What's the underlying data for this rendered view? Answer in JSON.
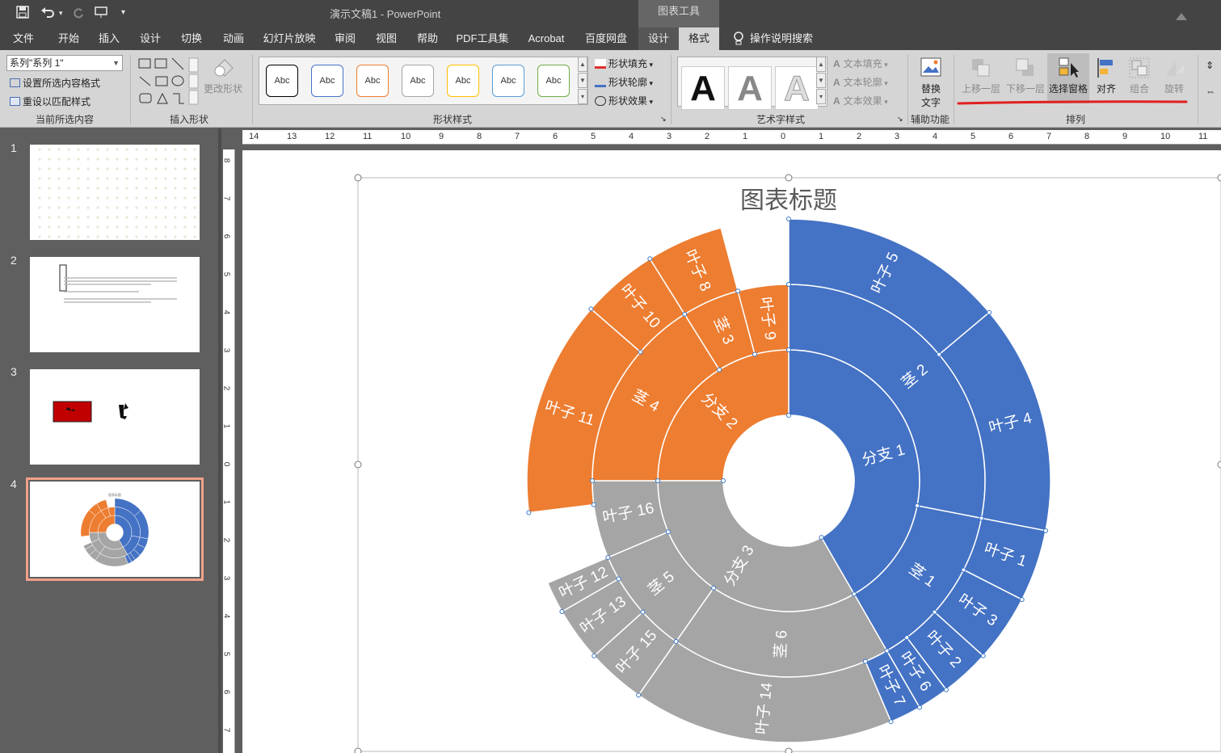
{
  "window": {
    "title": "演示文稿1  -  PowerPoint",
    "tool_context": "图表工具"
  },
  "quick_access": [
    "save-icon",
    "undo-icon",
    "redo-icon",
    "slideshow-icon",
    "customize-icon"
  ],
  "tabs": [
    {
      "label": "文件"
    },
    {
      "label": "开始"
    },
    {
      "label": "插入"
    },
    {
      "label": "设计"
    },
    {
      "label": "切换"
    },
    {
      "label": "动画"
    },
    {
      "label": "幻灯片放映"
    },
    {
      "label": "审阅"
    },
    {
      "label": "视图"
    },
    {
      "label": "帮助"
    },
    {
      "label": "PDF工具集"
    },
    {
      "label": "Acrobat"
    },
    {
      "label": "百度网盘"
    },
    {
      "label": "设计"
    },
    {
      "label": "格式"
    },
    {
      "label": "操作说明搜索"
    }
  ],
  "ribbon": {
    "current_selection": {
      "combo_value": "系列\"系列 1\"",
      "format_selection": "设置所选内容格式",
      "reset_style": "重设以匹配样式",
      "group_label": "当前所选内容"
    },
    "insert_shapes": {
      "change_shape": "更改形状",
      "group_label": "插入形状"
    },
    "shape_styles": {
      "sample_text": "Abc",
      "fill": "形状填充",
      "outline": "形状轮廓",
      "effects": "形状效果",
      "group_label": "形状样式",
      "swatch_colors": [
        "#000000",
        "#4472c4",
        "#ed7d31",
        "#a5a5a5",
        "#ffc000",
        "#5b9bd5",
        "#70ad47"
      ]
    },
    "wordart": {
      "sample": "A",
      "text_fill": "文本填充",
      "text_outline": "文本轮廓",
      "text_effects": "文本效果",
      "group_label": "艺术字样式"
    },
    "accessibility": {
      "alt_text_line1": "替换",
      "alt_text_line2": "文字",
      "group_label": "辅助功能"
    },
    "arrange": {
      "bring_forward": "上移一层",
      "send_backward": "下移一层",
      "selection_pane": "选择窗格",
      "align": "对齐",
      "group": "组合",
      "rotate": "旋转",
      "group_label": "排列",
      "annotation_color": "#e0201e"
    }
  },
  "slides": [
    {
      "number": "1"
    },
    {
      "number": "2"
    },
    {
      "number": "3"
    },
    {
      "number": "4"
    }
  ],
  "ruler": {
    "horizontal": [
      "14",
      "13",
      "12",
      "11",
      "10",
      "9",
      "8",
      "7",
      "6",
      "5",
      "4",
      "3",
      "2",
      "1",
      "0",
      "1",
      "2",
      "3",
      "4",
      "5",
      "6",
      "7",
      "8",
      "9",
      "10",
      "11"
    ],
    "vertical": [
      "8",
      "7",
      "6",
      "5",
      "4",
      "3",
      "2",
      "1",
      "0",
      "1",
      "2",
      "3",
      "4",
      "5",
      "6",
      "7"
    ]
  },
  "chart_data": {
    "type": "sunburst",
    "title": "图表标题",
    "colors": {
      "分支 1": "#4472c4",
      "分支 2": "#ed7d31",
      "分支 3": "#a5a5a5"
    },
    "segments": [
      {
        "level": 1,
        "label": "分支 1",
        "branch": "分支 1",
        "start": 0,
        "end": 150
      },
      {
        "level": 1,
        "label": "分支 2",
        "branch": "分支 2",
        "start": 270,
        "end": 360
      },
      {
        "level": 1,
        "label": "分支 3",
        "branch": "分支 3",
        "start": 150,
        "end": 270
      },
      {
        "level": 2,
        "label": "茎 2",
        "branch": "分支 1",
        "start": 0,
        "end": 101
      },
      {
        "level": 2,
        "label": "茎 1",
        "branch": "分支 1",
        "start": 101,
        "end": 150
      },
      {
        "level": 2,
        "label": "茎 6",
        "branch": "分支 3",
        "start": 150,
        "end": 215
      },
      {
        "level": 2,
        "label": "茎 5",
        "branch": "分支 3",
        "start": 215,
        "end": 247
      },
      {
        "level": 2,
        "label": "叶子 16",
        "branch": "分支 3",
        "start": 247,
        "end": 270
      },
      {
        "level": 2,
        "label": "茎 4",
        "branch": "分支 2",
        "start": 270,
        "end": 328
      },
      {
        "level": 2,
        "label": "茎 3",
        "branch": "分支 2",
        "start": 328,
        "end": 345
      },
      {
        "level": 2,
        "label": "叶子 9",
        "branch": "分支 2",
        "start": 345,
        "end": 360
      },
      {
        "level": 3,
        "label": "叶子 5",
        "branch": "分支 1",
        "start": 0,
        "end": 50
      },
      {
        "level": 3,
        "label": "叶子 4",
        "branch": "分支 1",
        "start": 50,
        "end": 101
      },
      {
        "level": 3,
        "label": "叶子 1",
        "branch": "分支 1",
        "start": 101,
        "end": 117
      },
      {
        "level": 3,
        "label": "叶子 3",
        "branch": "分支 1",
        "start": 117,
        "end": 132
      },
      {
        "level": 3,
        "label": "叶子 2",
        "branch": "分支 1",
        "start": 132,
        "end": 143
      },
      {
        "level": 3,
        "label": "叶子 6",
        "branch": "分支 1",
        "start": 143,
        "end": 150
      },
      {
        "level": 3,
        "label": "叶子 7",
        "branch": "分支 1",
        "start": 150,
        "end": 157
      },
      {
        "level": 3,
        "label": "叶子 14",
        "branch": "分支 3",
        "start": 157,
        "end": 215
      },
      {
        "level": 3,
        "label": "叶子 15",
        "branch": "分支 3",
        "start": 215,
        "end": 228
      },
      {
        "level": 3,
        "label": "叶子 13",
        "branch": "分支 3",
        "start": 228,
        "end": 240
      },
      {
        "level": 3,
        "label": "叶子 12",
        "branch": "分支 3",
        "start": 240,
        "end": 247
      },
      {
        "level": 3,
        "label": "叶子 11",
        "branch": "分支 2",
        "start": 263,
        "end": 311
      },
      {
        "level": 3,
        "label": "叶子 10",
        "branch": "分支 2",
        "start": 311,
        "end": 328
      },
      {
        "level": 3,
        "label": "叶子 8",
        "branch": "分支 2",
        "start": 328,
        "end": 345
      }
    ]
  }
}
